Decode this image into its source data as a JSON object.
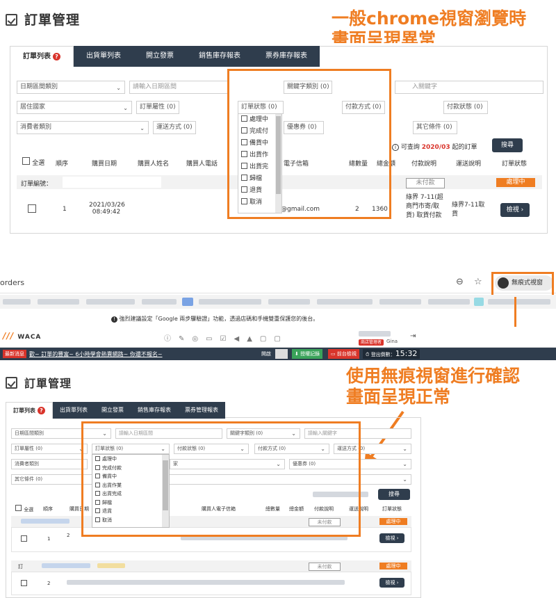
{
  "top": {
    "page_title": "訂單管理",
    "tabs": [
      {
        "label": "訂單列表",
        "active": true
      },
      {
        "label": "出貨單列表"
      },
      {
        "label": "開立發票"
      },
      {
        "label": "銷售庫存報表"
      },
      {
        "label": "票券庫存報表"
      }
    ],
    "filters": {
      "date_type": "日期區間類別",
      "date_placeholder": "請輸入日期區間",
      "keyword_type": "關鍵字類別 (0)",
      "keyword_placeholder": "入關鍵字",
      "country": "居住國家",
      "order_attr": "訂單屬性 (0)",
      "order_status": "訂單狀態 (0)",
      "payment_method": "付款方式 (0)",
      "payment_status": "付款狀態 (0)",
      "consumer_type": "消費者類別",
      "delivery": "運送方式 (0)",
      "discount": "優惠券 (0)",
      "other": "其它條件 (0)"
    },
    "query_note": "可查詢",
    "query_date": "2020/03",
    "query_suffix": "起的訂單",
    "search_btn": "搜尋",
    "columns": [
      "全選",
      "順序",
      "購買日期",
      "購買人姓名",
      "購買人電話",
      "電子信箱",
      "總數量",
      "總金額",
      "付款說明",
      "運送說明",
      "訂單狀態"
    ],
    "order_no_label": "訂單編號：",
    "unpaid": "未付款",
    "processing": "處理中",
    "row": {
      "index": "1",
      "date": "2021/03/26",
      "time": "08:49:42",
      "email": "@gmail.com",
      "qty": "2",
      "amount": "1360",
      "payment_desc": "綠界 7-11(超商門市寄/取貨) 取貨付款",
      "delivery_desc": "綠界7-11取貨",
      "view_btn": "檢視 ›"
    },
    "dropdown_options": [
      "處理中",
      "完成付",
      "備貨中",
      "出貨作",
      "出貨完",
      "歸檔",
      "退貨",
      "取消"
    ]
  },
  "annotation_top": [
    "一般chrome視窗瀏覽時",
    "畫面呈現異常"
  ],
  "chrome": {
    "url_fragment": "orders",
    "incognito_label": "無痕式視窗",
    "zoom_icon": "⊖",
    "star_icon": "☆"
  },
  "notice": "強烈建議設定「Google 兩步驟驗證」功能，透過店碼和手機雙重保護您的後台。",
  "waca": {
    "logo": "WACA",
    "role": "商店管理者",
    "user": "Gina"
  },
  "news": {
    "tag": "最新消息",
    "text": "歡~ 訂單的豐富~ 6小時學會熱賣網路~ 你還不報名~",
    "switch_label": "開啟",
    "records_btn": "授權記錄",
    "frontend_btn": "前台檢視",
    "timer_label": "登出倒數：",
    "timer": "15:32"
  },
  "annotation_bottom": [
    "使用無痕視窗進行確認",
    "畫面呈現正常"
  ],
  "bottom": {
    "page_title": "訂單管理",
    "tabs": [
      {
        "label": "訂單列表",
        "active": true
      },
      {
        "label": "出貨單列表"
      },
      {
        "label": "開立發票"
      },
      {
        "label": "銷售庫存報表"
      },
      {
        "label": "票券管理報表"
      }
    ],
    "filters": {
      "date_type": "日期區間類別",
      "date_placeholder": "請輸入日期區間",
      "keyword_type": "關鍵字類別 (0)",
      "keyword_placeholder": "請輸入關鍵字",
      "order_attr": "訂單屬性 (0)",
      "order_status": "訂單狀態 (0)",
      "payment_status": "付款狀態 (0)",
      "payment_method": "付款方式 (0)",
      "delivery": "運送方式 (0)",
      "consumer_type": "消費者類別",
      "country_frag": "家",
      "discount": "優惠券 (0)",
      "other": "其它條件 (0)"
    },
    "search_btn": "搜尋",
    "columns": [
      "全選",
      "順序",
      "購買日期",
      "購買人電子信箱",
      "總數量",
      "總金額",
      "付款說明",
      "運送說明",
      "訂單狀態"
    ],
    "unpaid": "未付款",
    "processing": "處理中",
    "rows": [
      {
        "index": "1",
        "date_frag": "2",
        "view_btn": "檢視 ›"
      },
      {
        "index": "2",
        "view_btn": "檢視 ›"
      }
    ],
    "order_no_frag": "訂",
    "dropdown_options": [
      "處理中",
      "完成付款",
      "備貨中",
      "出貨作業",
      "出貨完成",
      "歸檔",
      "退貨",
      "取消"
    ]
  },
  "colors": {
    "accent": "#ef7d22",
    "nav": "#2f3d4d",
    "danger": "#d9342b"
  }
}
